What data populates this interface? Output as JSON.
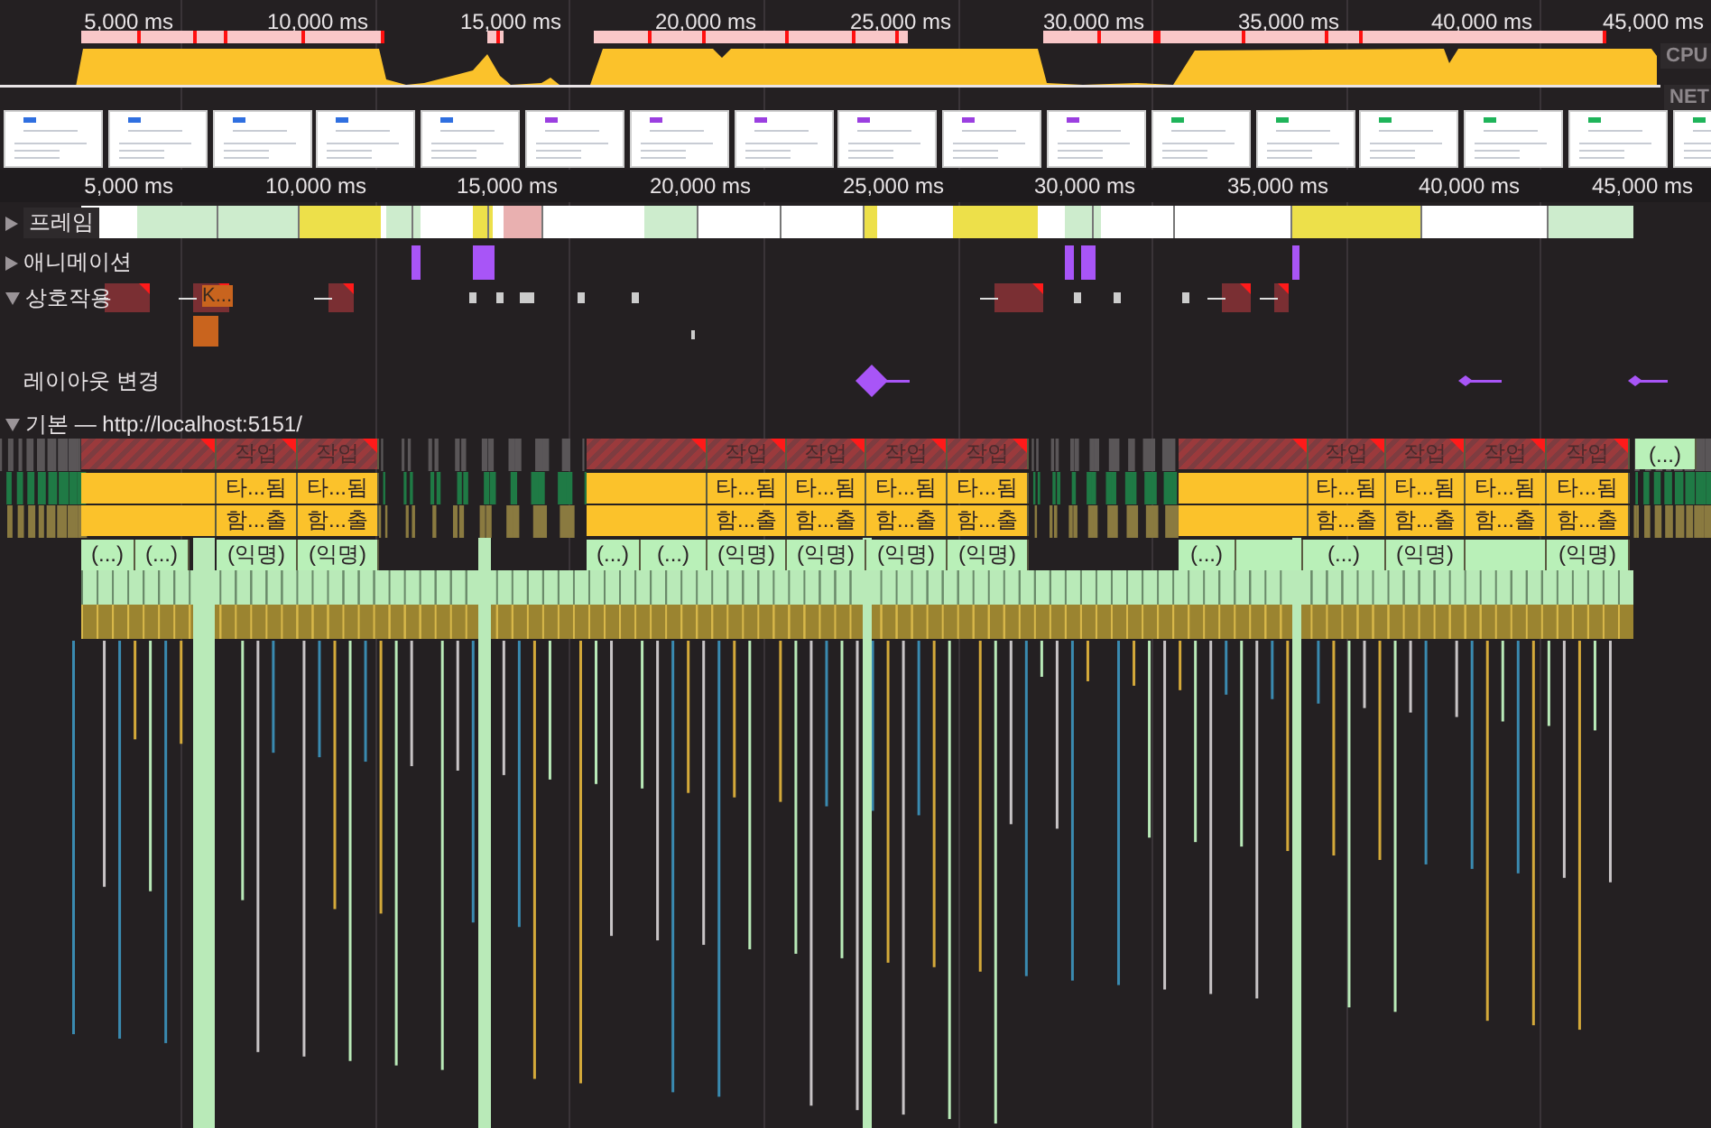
{
  "overview": {
    "ticks": [
      "5,000 ms",
      "10,000 ms",
      "15,000 ms",
      "20,000 ms",
      "25,000 ms",
      "30,000 ms",
      "35,000 ms",
      "40,000 ms",
      "45,000 ms"
    ],
    "cpu_label": "CPU",
    "net_label": "NET"
  },
  "filmstrip": [
    {
      "color": "#2f6fe0"
    },
    {
      "color": "#2f6fe0"
    },
    {
      "color": "#2f6fe0"
    },
    {
      "color": "#2f6fe0"
    },
    {
      "color": "#2f6fe0"
    },
    {
      "color": "#9b3fe0"
    },
    {
      "color": "#9b3fe0"
    },
    {
      "color": "#9b3fe0"
    },
    {
      "color": "#9b3fe0"
    },
    {
      "color": "#9b3fe0"
    },
    {
      "color": "#9b3fe0"
    },
    {
      "color": "#1fb45a"
    },
    {
      "color": "#1fb45a"
    },
    {
      "color": "#1fb45a"
    },
    {
      "color": "#1fb45a"
    },
    {
      "color": "#1fb45a"
    },
    {
      "color": "#1fb45a"
    }
  ],
  "ruler": {
    "ticks": [
      "5,000 ms",
      "10,000 ms",
      "15,000 ms",
      "20,000 ms",
      "25,000 ms",
      "30,000 ms",
      "35,000 ms",
      "40,000 ms",
      "45,000 ms"
    ]
  },
  "tracks": [
    {
      "kind": "frames",
      "label": "프레임",
      "expanded": false
    },
    {
      "kind": "animations",
      "label": "애니메이션",
      "expanded": false
    },
    {
      "kind": "interactions",
      "label": "상호작용",
      "expanded": true,
      "event_label": "K..."
    },
    {
      "kind": "layout_shifts",
      "label": "레이아웃 변경"
    },
    {
      "kind": "main",
      "label": "기본 — http://localhost:5151/",
      "expanded": true
    }
  ],
  "flame_rows": [
    {
      "blocks": [
        "작업",
        "작업",
        "작업",
        "작업",
        "작업",
        "작업",
        "작업",
        "작업",
        "작업",
        "작업",
        "(...)"
      ]
    },
    {
      "blocks": [
        "타...됨",
        "타...됨",
        "타...됨",
        "타...됨",
        "타...됨",
        "타...됨",
        "타...됨",
        "타...됨",
        "타...됨",
        "타...됨"
      ]
    },
    {
      "blocks": [
        "함...출",
        "함...출",
        "함...출",
        "함...출",
        "함...출",
        "함...출",
        "함...출",
        "함...출",
        "함...출",
        "함...출"
      ]
    },
    {
      "blocks": [
        "(...)",
        "(...)",
        "(익명)",
        "(익명)",
        "(...)",
        "(...)",
        "(익명)",
        "(익명)",
        "(익명)",
        "(익명)",
        "(...)",
        "(...)",
        "(익명)",
        "(익명)"
      ]
    }
  ]
}
